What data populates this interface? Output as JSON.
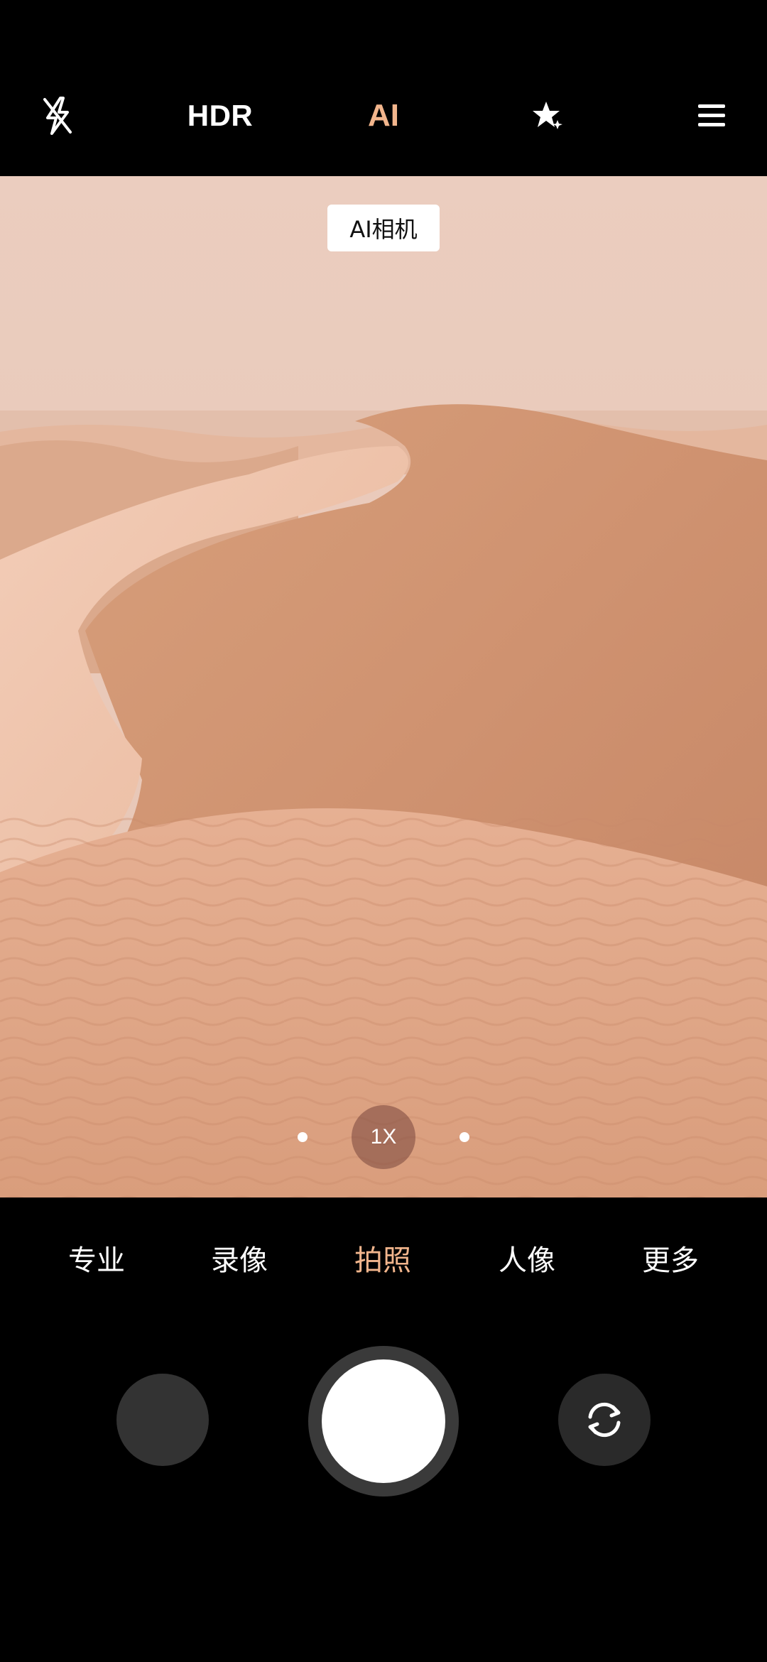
{
  "top_bar": {
    "flash_icon": "flash-off-icon",
    "hdr_label": "HDR",
    "ai_label": "AI",
    "beauty_icon": "sparkle-icon",
    "menu_icon": "menu-icon",
    "accent_color": "#f2b58c"
  },
  "viewfinder": {
    "scene_badge": "AI相机",
    "zoom_label": "1X"
  },
  "modes": {
    "items": [
      {
        "label": "专业"
      },
      {
        "label": "录像"
      },
      {
        "label": "拍照"
      },
      {
        "label": "人像"
      },
      {
        "label": "更多"
      }
    ],
    "selected": "拍照"
  },
  "controls": {
    "gallery_icon": "gallery-thumbnail",
    "shutter_icon": "shutter-button",
    "switch_icon": "camera-switch-icon"
  }
}
